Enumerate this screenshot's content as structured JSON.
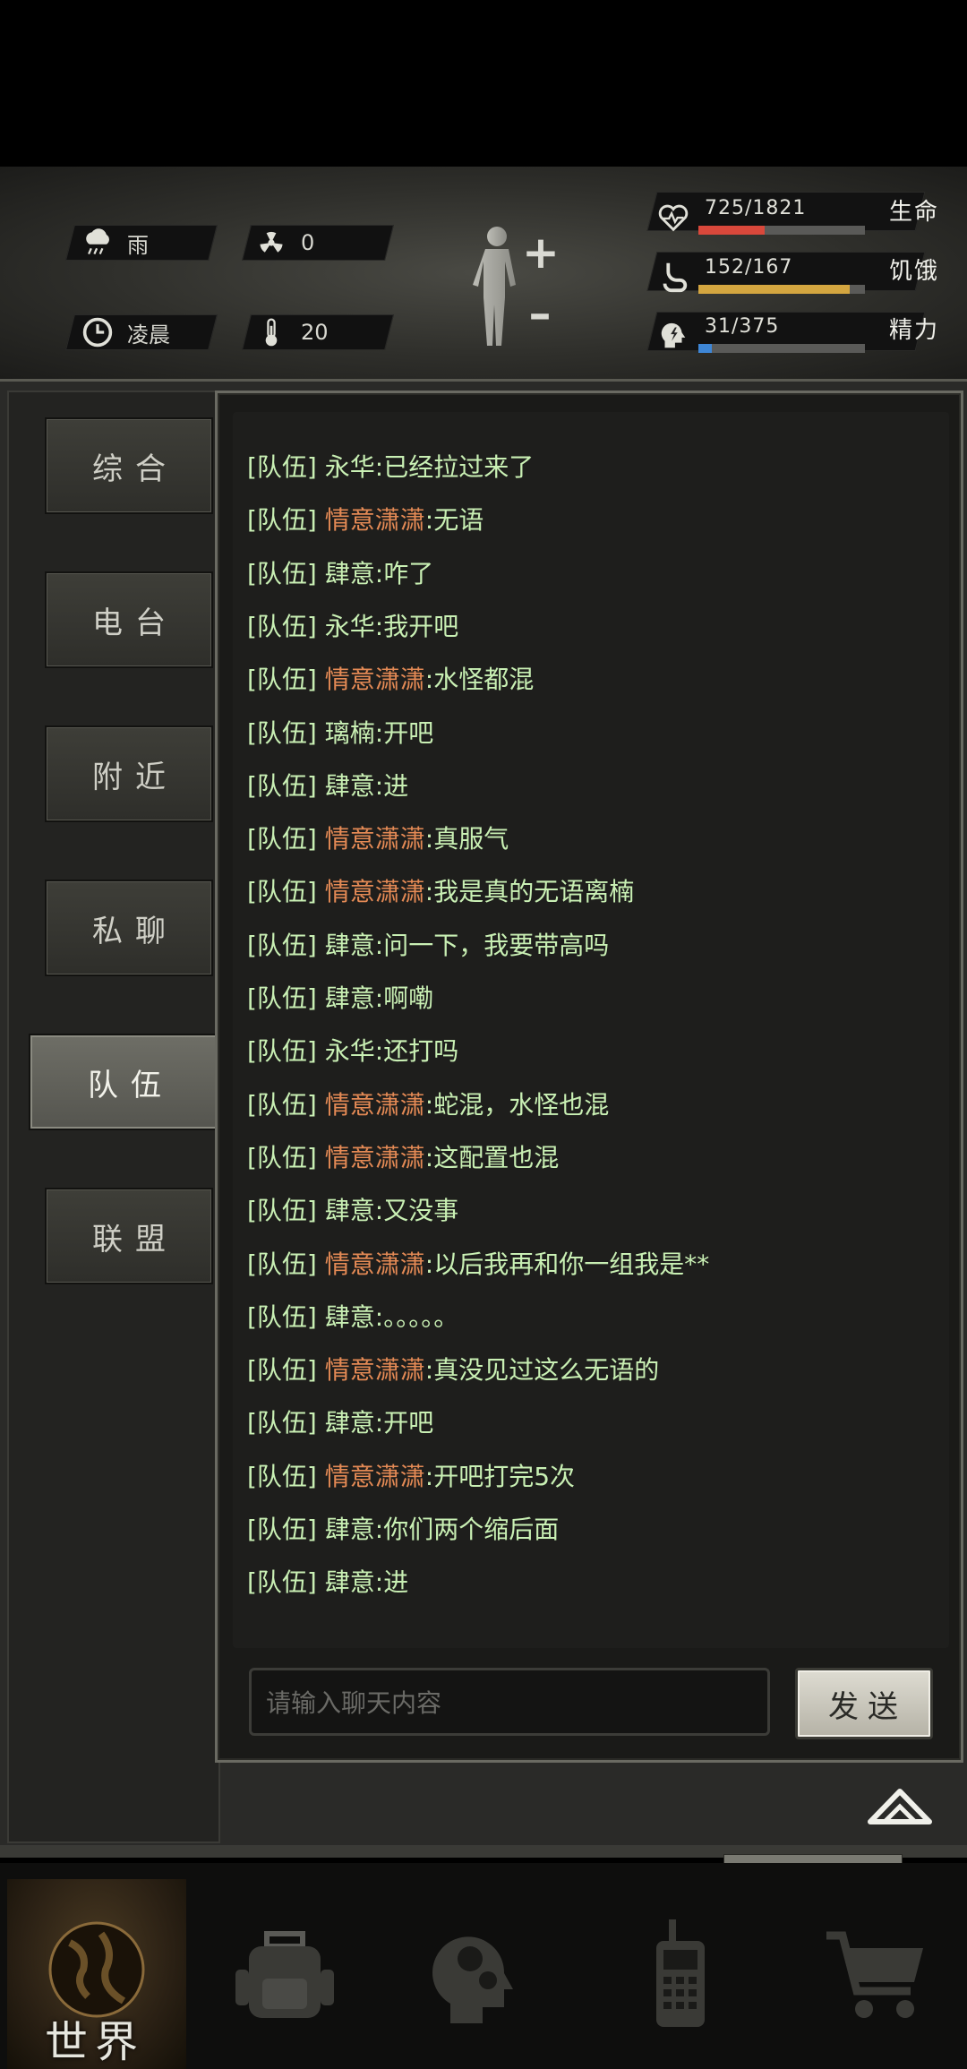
{
  "status": {
    "weather": {
      "icon": "rain-cloud-icon",
      "label": "雨"
    },
    "radiation": {
      "icon": "radiation-icon",
      "value": "0"
    },
    "time_of_day": {
      "icon": "clock-icon",
      "label": "凌晨"
    },
    "temperature": {
      "icon": "thermometer-icon",
      "value": "20"
    },
    "vitals": [
      {
        "name": "health",
        "icon": "heart-icon",
        "value": "725/1821",
        "label": "生命",
        "fraction": 0.398,
        "color": "#d9483b"
      },
      {
        "name": "hunger",
        "icon": "stomach-icon",
        "value": "152/167",
        "label": "饥饿",
        "fraction": 0.91,
        "color": "#d4a640"
      },
      {
        "name": "energy",
        "icon": "energy-head-icon",
        "value": "31/375",
        "label": "精力",
        "fraction": 0.083,
        "color": "#3e86d6"
      }
    ]
  },
  "tabs": [
    {
      "id": "general",
      "label": "综合",
      "active": false
    },
    {
      "id": "radio",
      "label": "电台",
      "active": false
    },
    {
      "id": "nearby",
      "label": "附近",
      "active": false
    },
    {
      "id": "private",
      "label": "私聊",
      "active": false
    },
    {
      "id": "team",
      "label": "队伍",
      "active": true
    },
    {
      "id": "alliance",
      "label": "联盟",
      "active": false
    }
  ],
  "chat": {
    "channel_tag": "[队伍]",
    "messages": [
      {
        "sender": "永华",
        "text": ":已经拉过来了",
        "sender_color": "green"
      },
      {
        "sender": "情意潇潇",
        "text": ":无语",
        "sender_color": "orange"
      },
      {
        "sender": "肆意",
        "text": ":咋了",
        "sender_color": "green"
      },
      {
        "sender": "永华",
        "text": ":我开吧",
        "sender_color": "green"
      },
      {
        "sender": "情意潇潇",
        "text": ":水怪都混",
        "sender_color": "orange"
      },
      {
        "sender": "璃楠",
        "text": ":开吧",
        "sender_color": "green"
      },
      {
        "sender": "肆意",
        "text": ":进",
        "sender_color": "green"
      },
      {
        "sender": "情意潇潇",
        "text": ":真服气",
        "sender_color": "orange"
      },
      {
        "sender": "情意潇潇",
        "text": ":我是真的无语离楠",
        "sender_color": "orange"
      },
      {
        "sender": "肆意",
        "text": ":问一下，我要带高吗",
        "sender_color": "green"
      },
      {
        "sender": "肆意",
        "text": ":啊嘞",
        "sender_color": "green"
      },
      {
        "sender": "永华",
        "text": ":还打吗",
        "sender_color": "green"
      },
      {
        "sender": "情意潇潇",
        "text": ":蛇混，水怪也混",
        "sender_color": "orange"
      },
      {
        "sender": "情意潇潇",
        "text": ":这配置也混",
        "sender_color": "orange"
      },
      {
        "sender": "肆意",
        "text": ":又没事",
        "sender_color": "green"
      },
      {
        "sender": "情意潇潇",
        "text": ":以后我再和你一组我是**",
        "sender_color": "orange"
      },
      {
        "sender": "肆意",
        "text": ":。。。。。",
        "sender_color": "green"
      },
      {
        "sender": "情意潇潇",
        "text": ":真没见过这么无语的",
        "sender_color": "orange"
      },
      {
        "sender": "肆意",
        "text": ":开吧",
        "sender_color": "green"
      },
      {
        "sender": "情意潇潇",
        "text": ":开吧打完5次",
        "sender_color": "orange"
      },
      {
        "sender": "肆意",
        "text": ":你们两个缩后面",
        "sender_color": "green"
      },
      {
        "sender": "肆意",
        "text": ":进",
        "sender_color": "green"
      }
    ],
    "input_placeholder": "请输入聊天内容",
    "send_label": "发送"
  },
  "bottom_nav": [
    {
      "id": "world",
      "icon": "globe-icon",
      "label": "世界",
      "active": true
    },
    {
      "id": "backpack",
      "icon": "backpack-icon",
      "active": false
    },
    {
      "id": "skills",
      "icon": "head-gears-icon",
      "active": false
    },
    {
      "id": "radio",
      "icon": "walkie-talkie-icon",
      "active": false
    },
    {
      "id": "shop",
      "icon": "shopping-cart-icon",
      "active": false
    }
  ],
  "colors": {
    "message_green": "#c9f0b4",
    "sender_orange": "#e48a55",
    "panel_bg": "#1e1e1c"
  }
}
